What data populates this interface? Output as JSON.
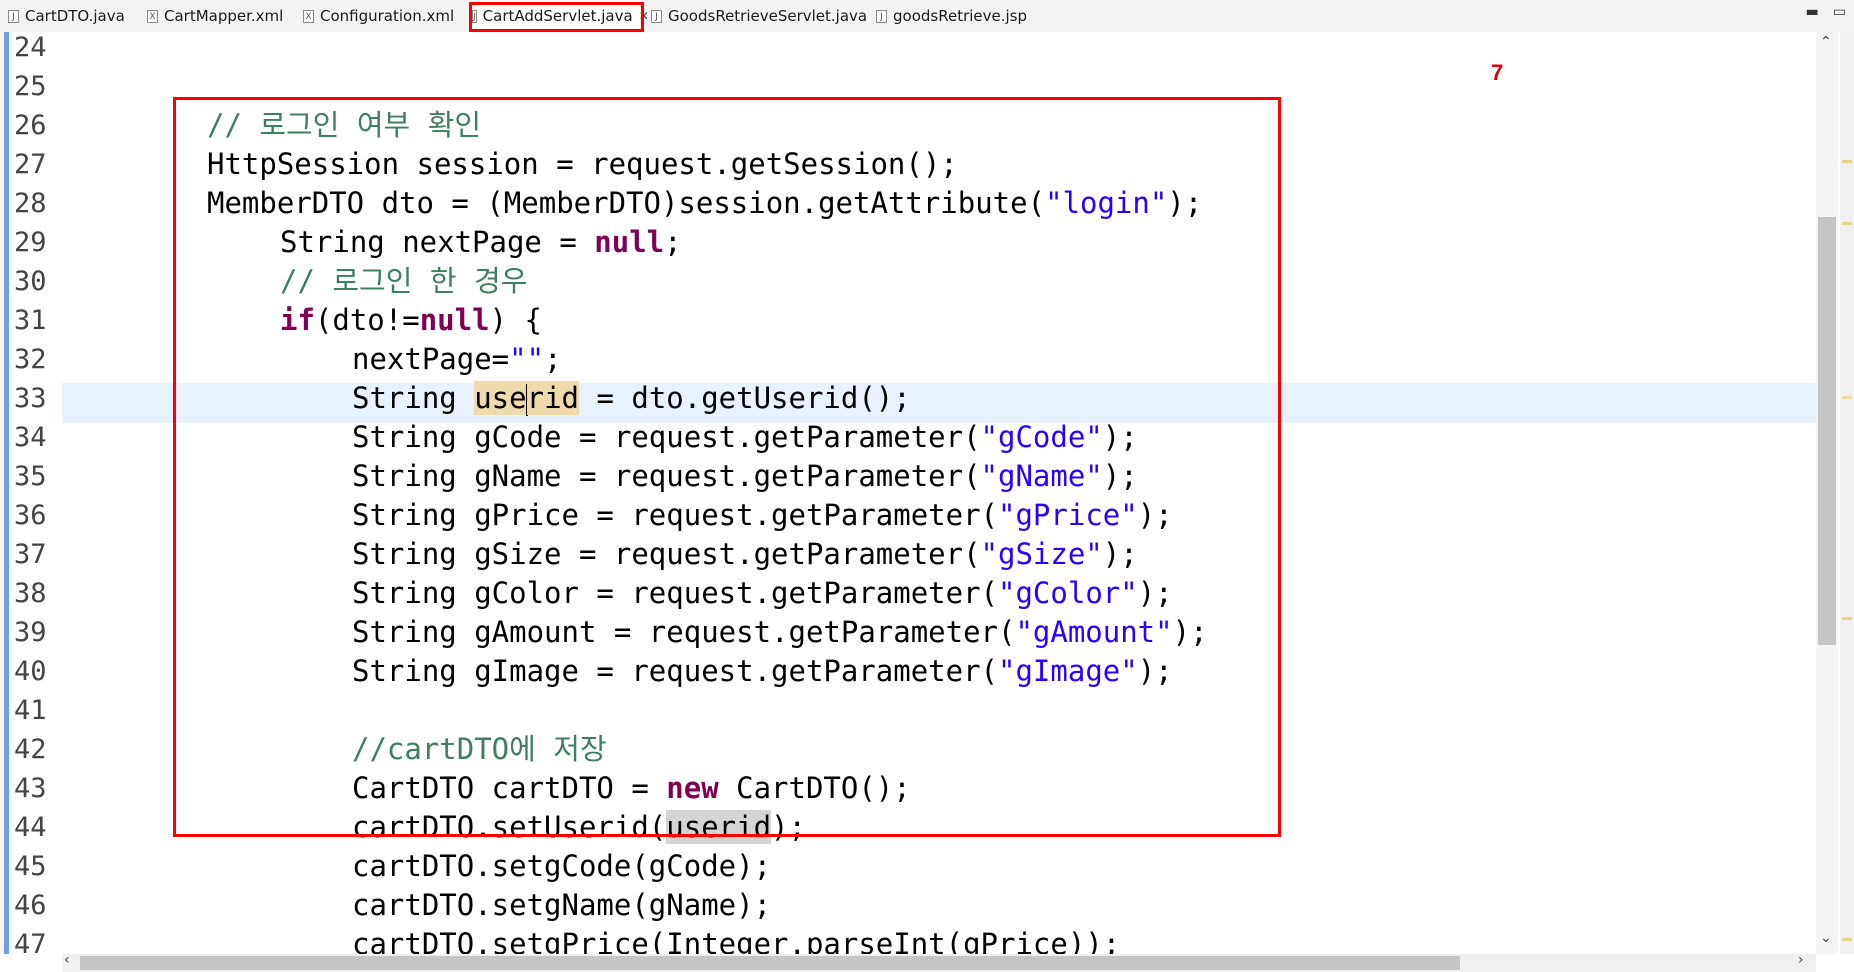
{
  "tabs": [
    {
      "label": "CartDTO.java",
      "icon": "java-file-icon",
      "active": false
    },
    {
      "label": "CartMapper.xml",
      "icon": "xml-file-icon",
      "active": false
    },
    {
      "label": "Configuration.xml",
      "icon": "xml-file-icon",
      "active": false
    },
    {
      "label": "CartAddServlet.java",
      "icon": "java-file-icon",
      "active": true
    },
    {
      "label": "GoodsRetrieveServlet.java",
      "icon": "java-file-icon",
      "active": false
    },
    {
      "label": "goodsRetrieve.jsp",
      "icon": "jsp-file-icon",
      "active": false
    }
  ],
  "annotation": {
    "number": "7",
    "color": "#ff0000"
  },
  "colors": {
    "comment": "#3f7f5f",
    "keyword": "#7f0055",
    "string": "#2a00ff",
    "current_line": "#e8f2fe",
    "highlight": "#f0d9aa"
  },
  "editor": {
    "line_numbers": [
      "24",
      "25",
      "26",
      "27",
      "28",
      "29",
      "30",
      "31",
      "32",
      "33",
      "34",
      "35",
      "36",
      "37",
      "38",
      "39",
      "40",
      "41",
      "42",
      "43",
      "44",
      "45",
      "46",
      "47"
    ],
    "lines": [
      [],
      [],
      [
        {
          "t": "// 로그인 여부 확인",
          "c": "cm"
        }
      ],
      [
        {
          "t": "HttpSession session = request.getSession();"
        }
      ],
      [
        {
          "t": "MemberDTO dto = (MemberDTO)session.getAttribute("
        },
        {
          "t": "\"login\"",
          "c": "st"
        },
        {
          "t": ");"
        }
      ],
      [
        {
          "t": "String nextPage = "
        },
        {
          "t": "null",
          "c": "kw"
        },
        {
          "t": ";"
        }
      ],
      [
        {
          "t": "// 로그인 한 경우",
          "c": "cm"
        }
      ],
      [
        {
          "t": "if",
          "c": "kw"
        },
        {
          "t": "(dto!="
        },
        {
          "t": "null",
          "c": "kw"
        },
        {
          "t": ") {"
        }
      ],
      [
        {
          "t": "nextPage="
        },
        {
          "t": "\"\"",
          "c": "st"
        },
        {
          "t": ";"
        }
      ],
      [
        {
          "t": "String "
        },
        {
          "t": "use",
          "c": "hl"
        },
        {
          "t": "",
          "c": "caret"
        },
        {
          "t": "rid",
          "c": "hl"
        },
        {
          "t": " = dto.getUserid();"
        }
      ],
      [
        {
          "t": "String gCode = request.getParameter("
        },
        {
          "t": "\"gCode\"",
          "c": "st"
        },
        {
          "t": ");"
        }
      ],
      [
        {
          "t": "String gName = request.getParameter("
        },
        {
          "t": "\"gName\"",
          "c": "st"
        },
        {
          "t": ");"
        }
      ],
      [
        {
          "t": "String gPrice = request.getParameter("
        },
        {
          "t": "\"gPrice\"",
          "c": "st"
        },
        {
          "t": ");"
        }
      ],
      [
        {
          "t": "String gSize = request.getParameter("
        },
        {
          "t": "\"gSize\"",
          "c": "st"
        },
        {
          "t": ");"
        }
      ],
      [
        {
          "t": "String gColor = request.getParameter("
        },
        {
          "t": "\"gColor\"",
          "c": "st"
        },
        {
          "t": ");"
        }
      ],
      [
        {
          "t": "String gAmount = request.getParameter("
        },
        {
          "t": "\"gAmount\"",
          "c": "st"
        },
        {
          "t": ");"
        }
      ],
      [
        {
          "t": "String gImage = request.getParameter("
        },
        {
          "t": "\"gImage\"",
          "c": "st"
        },
        {
          "t": ");"
        }
      ],
      [],
      [
        {
          "t": "//cartDTO에 저장",
          "c": "cm"
        }
      ],
      [
        {
          "t": "CartDTO cartDTO = "
        },
        {
          "t": "new",
          "c": "kw"
        },
        {
          "t": " CartDTO();"
        }
      ],
      [
        {
          "t": "cartDTO.setUserid("
        },
        {
          "t": "userid",
          "c": "occ"
        },
        {
          "t": ");"
        }
      ],
      [
        {
          "t": "cartDTO.setgCode(gCode);"
        }
      ],
      [
        {
          "t": "cartDTO.setgName(gName);"
        }
      ],
      [
        {
          "t": "cartDTO.setgPrice(Integer.parseInt(gPrice));"
        }
      ]
    ]
  }
}
